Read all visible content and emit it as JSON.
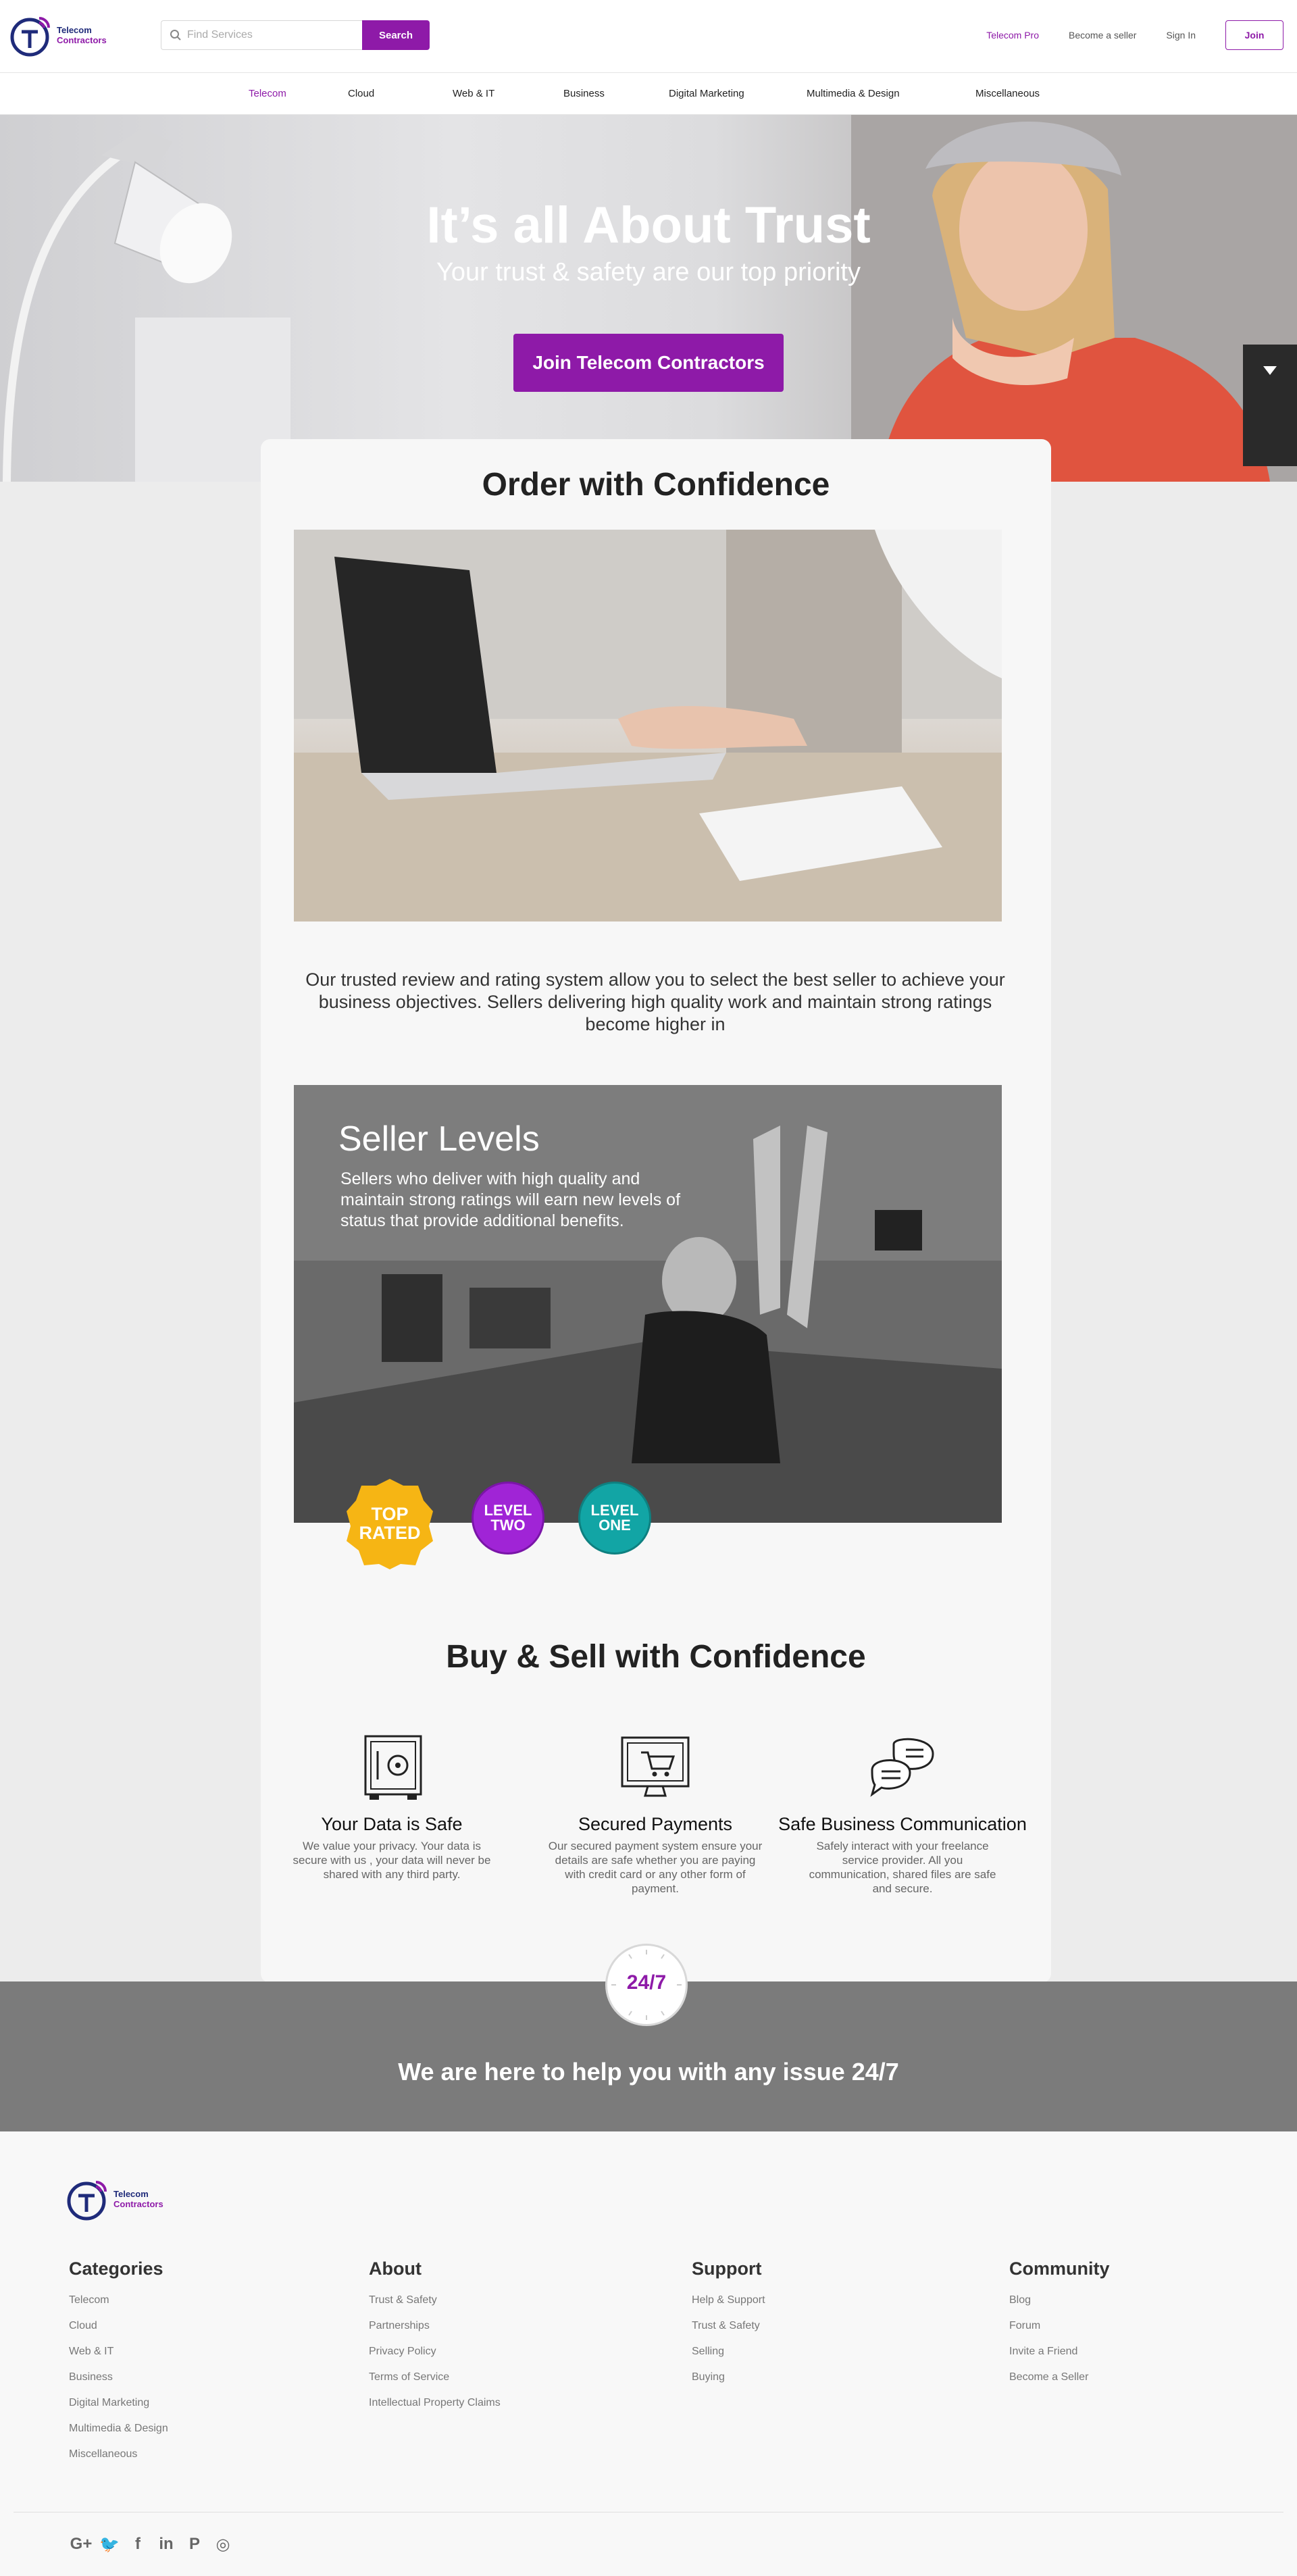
{
  "header": {
    "logo_line1": "Telecom",
    "logo_line2": "Contractors",
    "search_placeholder": "Find Services",
    "search_button": "Search",
    "links": {
      "pro": "Telecom Pro",
      "become_seller": "Become a seller",
      "sign_in": "Sign In",
      "join": "Join"
    }
  },
  "categories_nav": [
    "Telecom",
    "Cloud",
    "Web & IT",
    "Business",
    "Digital Marketing",
    "Multimedia & Design",
    "Miscellaneous"
  ],
  "hero": {
    "title": "It’s all About Trust",
    "subtitle": "Your trust & safety are our top priority",
    "cta": "Join Telecom Contractors"
  },
  "order": {
    "title": "Order with Confidence",
    "text": "Our trusted review and rating system allow you to select the best seller to achieve your business objectives. Sellers delivering high quality work and maintain strong ratings become higher in"
  },
  "seller_levels": {
    "title": "Seller Levels",
    "description": "Sellers who deliver with high quality and maintain strong ratings will earn new levels of status that provide additional benefits.",
    "badges": [
      {
        "line1": "TOP",
        "line2": "RATED",
        "color": "#f6b514"
      },
      {
        "line1": "LEVEL",
        "line2": "TWO",
        "color": "#a024d6"
      },
      {
        "line1": "LEVEL",
        "line2": "ONE",
        "color": "#12a5a5"
      }
    ]
  },
  "buy_sell": {
    "title": "Buy & Sell with Confidence",
    "features": [
      {
        "icon": "safe-icon",
        "title": "Your Data is Safe",
        "desc": "We value your privacy. Your data is secure with us , your data will never be shared with any third party."
      },
      {
        "icon": "cart-monitor-icon",
        "title": "Secured Payments",
        "desc": "Our secured payment system ensure your  details are safe whether you are paying with credit card or any other form of payment."
      },
      {
        "icon": "chat-bubbles-icon",
        "title": "Safe Business Communication",
        "desc": "Safely interact with your freelance service provider. All you communication, shared files are safe and secure."
      }
    ]
  },
  "support": {
    "clock_label": "24/7",
    "text": "We are here to help you with any issue 24/7"
  },
  "footer": {
    "columns": [
      {
        "title": "Categories",
        "items": [
          "Telecom",
          "Cloud",
          "Web & IT",
          "Business",
          "Digital Marketing",
          "Multimedia & Design",
          "Miscellaneous"
        ]
      },
      {
        "title": "About",
        "items": [
          "Trust & Safety",
          "Partnerships",
          "Privacy Policy",
          "Terms of Service",
          "Intellectual Property Claims"
        ]
      },
      {
        "title": "Support",
        "items": [
          "Help & Support",
          "Trust & Safety",
          "Selling",
          "Buying"
        ]
      },
      {
        "title": "Community",
        "items": [
          "Blog",
          "Forum",
          "Invite a Friend",
          "Become a Seller"
        ]
      }
    ],
    "social": [
      {
        "icon": "google-plus-icon",
        "glyph": "G+"
      },
      {
        "icon": "twitter-icon",
        "glyph": "🐦"
      },
      {
        "icon": "facebook-icon",
        "glyph": "f"
      },
      {
        "icon": "linkedin-icon",
        "glyph": "in"
      },
      {
        "icon": "pinterest-icon",
        "glyph": "P"
      },
      {
        "icon": "instagram-icon",
        "glyph": "◎"
      }
    ]
  },
  "colors": {
    "brand": "#8e1aa8",
    "logo_blue": "#1f2b7a"
  }
}
